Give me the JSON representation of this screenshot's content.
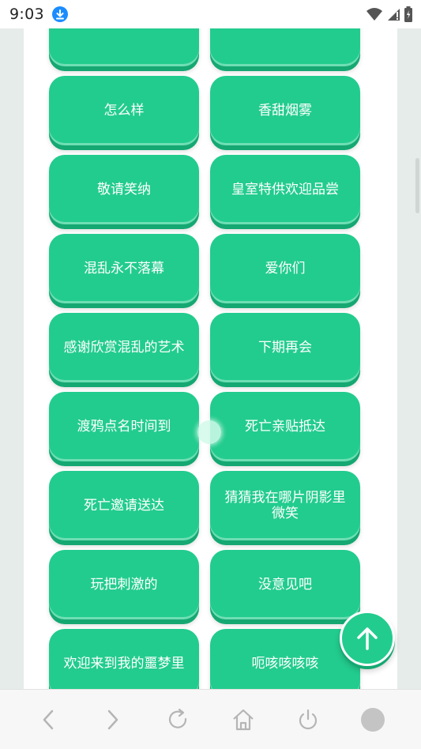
{
  "status_bar": {
    "time": "9:03"
  },
  "buttons": [
    "怎么样",
    "香甜烟雾",
    "敬请笑纳",
    "皇室特供欢迎品尝",
    "混乱永不落幕",
    "爱你们",
    "感谢欣赏混乱的艺术",
    "下期再会",
    "渡鸦点名时间到",
    "死亡亲贴抵达",
    "死亡邀请送达",
    "猜猜我在哪片阴影里微笑",
    "玩把刺激的",
    "没意见吧",
    "欢迎来到我的噩梦里",
    "呃咳咳咳咳"
  ],
  "colors": {
    "accent": "#22cc8e",
    "accent_dark": "#15a873",
    "download_badge": "#1a8cff"
  },
  "icons": [
    "download-icon",
    "wifi-icon",
    "signal-icon",
    "battery-icon",
    "arrow-up-icon",
    "back-icon",
    "forward-icon",
    "refresh-icon",
    "home-icon",
    "power-icon",
    "menu-circle-icon"
  ]
}
